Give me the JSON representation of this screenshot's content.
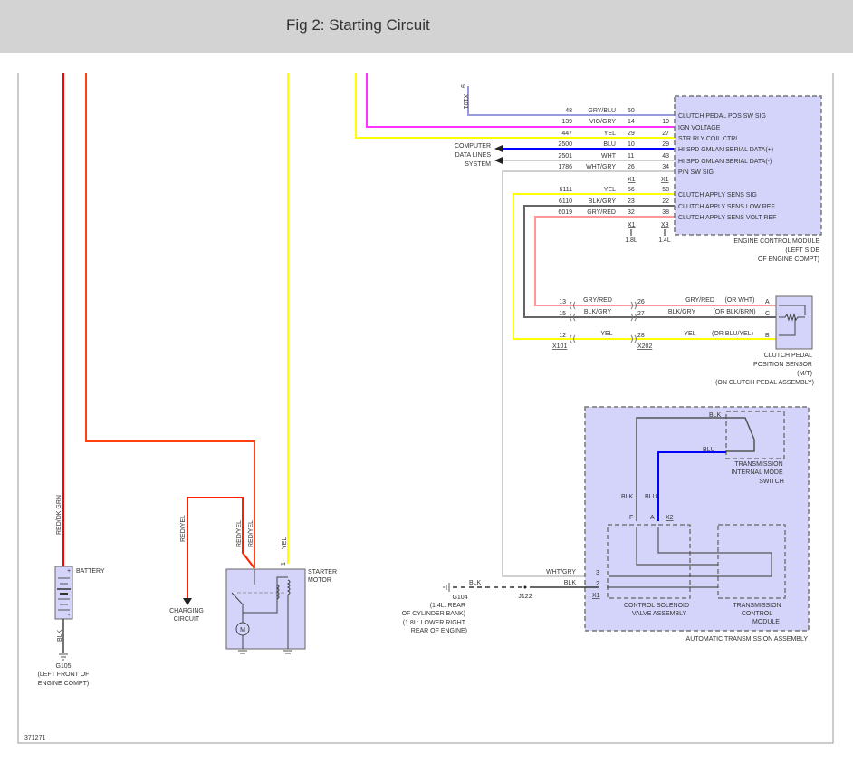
{
  "header": {
    "title": "Fig 2: Starting Circuit"
  },
  "diagram_id": "371271",
  "colors": {
    "red": "#ff0000",
    "orange_red": "#ff4010",
    "yellow": "#ffff00",
    "violet": "#ff33ff",
    "blue": "#0000ff",
    "lavender": "#9999dd",
    "white_wire": "#d0d0d0",
    "blk_gry": "#666666",
    "gry_red": "#ff9999",
    "module_fill": "#d4d4fb"
  },
  "left": {
    "red_dk_grn": "RED/DK GRN",
    "battery": "BATTERY",
    "blk": "BLK",
    "g105": "G105",
    "g105_loc1": "(LEFT FRONT OF",
    "g105_loc2": "ENGINE COMPT)",
    "red_yel_1": "RED/YEL",
    "red_yel_2": "RED/YEL",
    "red_yel_3": "RED/YEL",
    "charging1": "CHARGING",
    "charging2": "CIRCUIT",
    "yel": "YEL",
    "pin1": "1",
    "starter1": "STARTER",
    "starter2": "MOTOR",
    "motor_m": "M",
    "plus": "+",
    "minus": "-"
  },
  "ecm": {
    "x101": "X101",
    "x101_pin": "9",
    "computer1": "COMPUTER",
    "computer2": "DATA LINES",
    "computer3": "SYSTEM",
    "rows": [
      {
        "circuit": "48",
        "color": "GRY/BLU",
        "pin1": "50",
        "pin2": "",
        "label": "CLUTCH PEDAL POS SW SIG"
      },
      {
        "circuit": "139",
        "color": "VIO/GRY",
        "pin1": "14",
        "pin2": "19",
        "label": "IGN VOLTAGE"
      },
      {
        "circuit": "447",
        "color": "YEL",
        "pin1": "29",
        "pin2": "27",
        "label": "STR RLY COIL CTRL"
      },
      {
        "circuit": "2500",
        "color": "BLU",
        "pin1": "10",
        "pin2": "29",
        "label": "HI SPD GMLAN SERIAL DATA(+)"
      },
      {
        "circuit": "2501",
        "color": "WHT",
        "pin1": "11",
        "pin2": "43",
        "label": "HI SPD GMLAN SERIAL DATA(-)"
      },
      {
        "circuit": "1786",
        "color": "WHT/GRY",
        "pin1": "26",
        "pin2": "34",
        "label": "P/N SW SIG"
      },
      {
        "circuit": "6111",
        "color": "YEL",
        "pin1": "56",
        "pin2": "58",
        "label": "CLUTCH APPLY SENS SIG"
      },
      {
        "circuit": "6110",
        "color": "BLK/GRY",
        "pin1": "23",
        "pin2": "22",
        "label": "CLUTCH APPLY SENS LOW REF"
      },
      {
        "circuit": "6019",
        "color": "GRY/RED",
        "pin1": "32",
        "pin2": "38",
        "label": "CLUTCH APPLY SENS VOLT REF"
      }
    ],
    "conn_a": "X1",
    "conn_b": "X1",
    "conn_c": "X1",
    "conn_d": "X3",
    "eng_c": "1.8L",
    "eng_d": "1.4L",
    "name1": "ENGINE CONTROL MODULE",
    "name2": "(LEFT SIDE",
    "name3": "OF ENGINE COMPT)"
  },
  "clutch": {
    "rows": [
      {
        "p1": "13",
        "c1": "GRY/RED",
        "p2": "26",
        "c2": "GRY/RED",
        "alt": "(OR WHT)",
        "term": "A"
      },
      {
        "p1": "15",
        "c1": "BLK/GRY",
        "p2": "27",
        "c2": "BLK/GRY",
        "alt": "(OR BLK/BRN)",
        "term": "C"
      },
      {
        "p1": "12",
        "c1": "YEL",
        "p2": "28",
        "c2": "YEL",
        "alt": "(OR BLU/YEL)",
        "term": "B"
      }
    ],
    "x101": "X101",
    "x202": "X202",
    "name1": "CLUTCH PEDAL",
    "name2": "POSITION SENSOR",
    "name3": "(M/T)",
    "name4": "(ON CLUTCH PEDAL ASSEMBLY)"
  },
  "trans": {
    "blk_top": "BLK",
    "blu_top": "BLU",
    "blk_v": "BLK",
    "blu_v": "BLU",
    "pin_f": "F",
    "pin_a": "A",
    "x2": "X2",
    "ims1": "TRANSMISSION",
    "ims2": "INTERNAL MODE",
    "ims3": "SWITCH",
    "wht_gry": "WHT/GRY",
    "pin3": "3",
    "blk2": "BLK",
    "pin2": "2",
    "x1": "X1",
    "blk_g": "BLK",
    "g104": "G104",
    "g104_l1": "(1.4L: REAR",
    "g104_l2": "OF CYLINDER BANK)",
    "g104_l3": "(1.8L: LOWER RIGHT",
    "g104_l4": "REAR OF ENGINE)",
    "j122": "J122",
    "csv1": "CONTROL SOLENOID",
    "csv2": "VALVE ASSEMBLY",
    "tcm1": "TRANSMISSION",
    "tcm2": "CONTROL",
    "tcm3": "MODULE",
    "assembly": "AUTOMATIC TRANSMISSION ASSEMBLY"
  }
}
